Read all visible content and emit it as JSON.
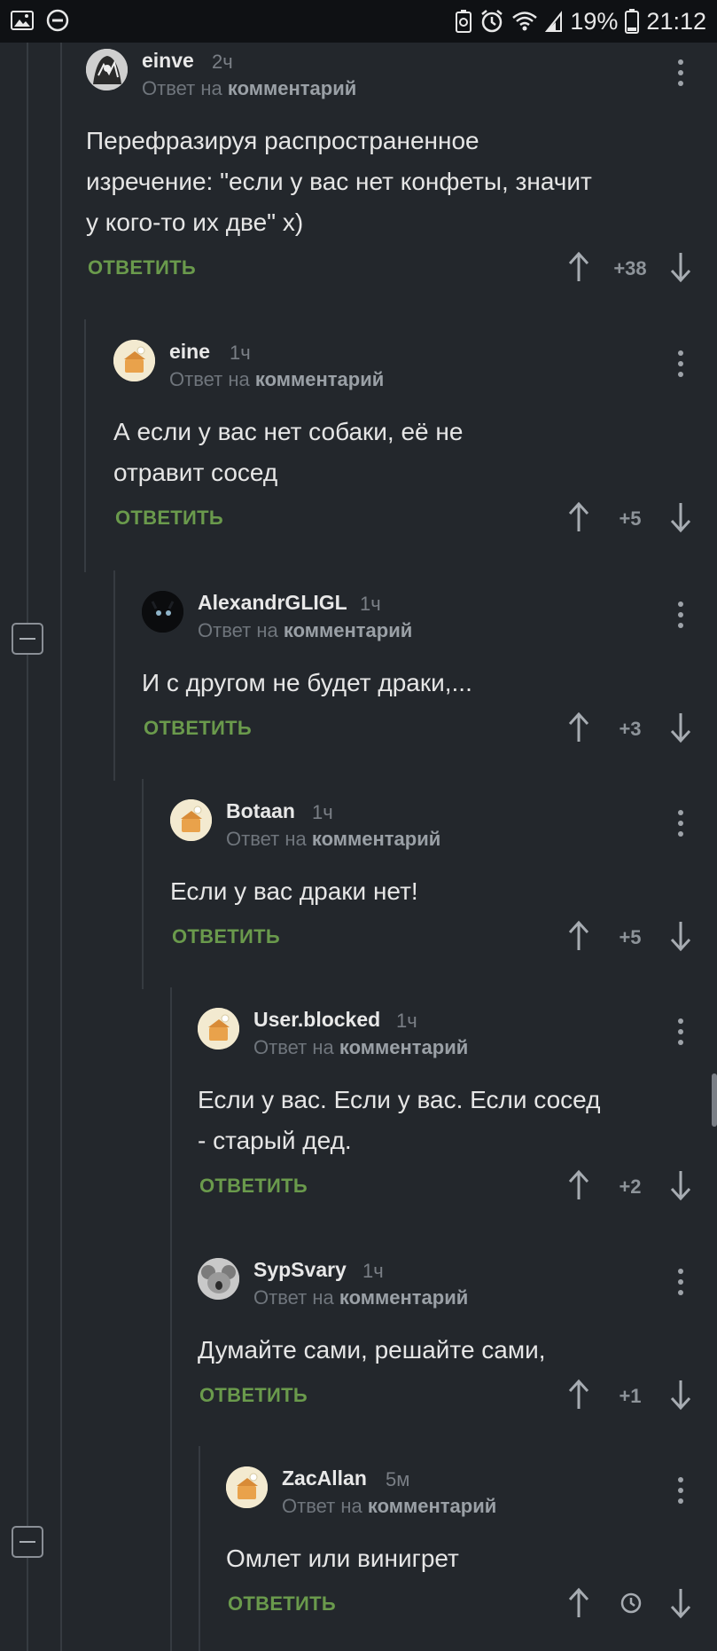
{
  "status_bar": {
    "battery": "19%",
    "time": "21:12"
  },
  "reply_to_prefix": "Ответ на",
  "reply_to_target": "комментарий",
  "reply_label": "ОТВЕТИТЬ",
  "colors": {
    "accent_green": "#6a9a4c",
    "background": "#23272c"
  },
  "comments": [
    {
      "author": "einve",
      "time": "2ч",
      "text_lines": [
        "Перефразируя распространенное",
        "изречение: \"если у вас нет конфеты, значит",
        "у кого-то их две\" х)"
      ],
      "rating": "+38",
      "avatar": "bw-illustration-avatar"
    },
    {
      "author": "eine",
      "time": "1ч",
      "text_lines": [
        "А если у вас нет собаки, её не",
        "отравит сосед"
      ],
      "rating": "+5",
      "avatar": "default-chef-avatar"
    },
    {
      "author": "AlexandrGLIGL",
      "time": "1ч",
      "text_lines": [
        "И с другом не будет драки,..."
      ],
      "rating": "+3",
      "avatar": "dark-cat-avatar"
    },
    {
      "author": "Botaan",
      "time": "1ч",
      "text_lines": [
        "Если у вас драки нет!"
      ],
      "rating": "+5",
      "avatar": "default-chef-avatar"
    },
    {
      "author": "User.blocked",
      "time": "1ч",
      "text_lines": [
        "Если у вас. Если у вас. Если сосед",
        "- старый дед."
      ],
      "rating": "+2",
      "avatar": "default-chef-avatar"
    },
    {
      "author": "SypSvary",
      "time": "1ч",
      "text_lines": [
        "Думайте сами, решайте сами,"
      ],
      "rating": "+1",
      "avatar": "koala-avatar"
    },
    {
      "author": "ZacAllan",
      "time": "5м",
      "text_lines": [
        "Омлет или винигрет"
      ],
      "rating": "",
      "rating_icon": "clock-icon",
      "avatar": "default-chef-avatar"
    }
  ]
}
